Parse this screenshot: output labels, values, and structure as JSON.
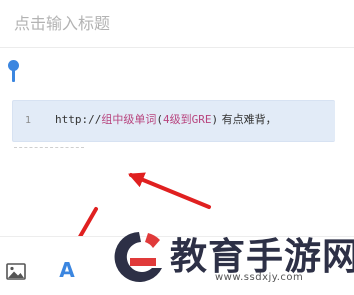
{
  "editor": {
    "title_placeholder": "点击输入标题",
    "code_block": {
      "line_number": "1",
      "tokens": {
        "scheme": "http://",
        "part1": "组中级单词",
        "part2": "(",
        "part3": "4级到GRE",
        "part4": ")",
        "part5": " 有点难背，"
      }
    }
  },
  "toolbar": {
    "image_icon": "image-icon",
    "font_icon_glyph": "A"
  },
  "annotations": {
    "arrow_color": "#e02020"
  },
  "watermark": {
    "name": "教育手游网",
    "url": "www.ssdxjy.com"
  },
  "colors": {
    "accent": "#3b86e0",
    "code_bg": "#e2ebf7",
    "code_string": "#b8447e"
  }
}
